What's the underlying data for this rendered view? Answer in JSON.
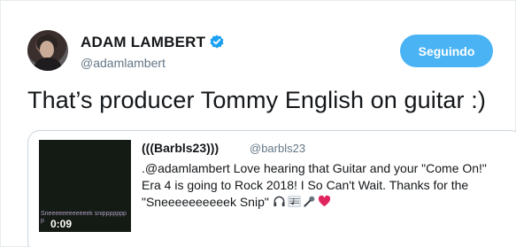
{
  "author": {
    "display_name": "ADAM LAMBERT",
    "handle": "@adamlambert",
    "verified": true,
    "avatar_icon": "user-avatar"
  },
  "follow_button": {
    "label": "Seguindo",
    "color": "#4ab3f4"
  },
  "tweet": {
    "text": "That’s producer Tommy English on guitar :)"
  },
  "quoted_tweet": {
    "display_name": "(((Barbls23)))",
    "handle": "@barbls23",
    "text": ".@adamlambert Love hearing that Guitar and your \"Come On!\" Era 4 is going to Rock 2018! I So Can't Wait. Thanks for the \"Sneeeeeeeeeek Snip\"",
    "emojis": [
      "headphones-icon",
      "musical-score-icon",
      "microphone-icon",
      "heart-icon"
    ],
    "media": {
      "duration": "0:09",
      "overlay_text": "Sneeeeeeeeeeeek snipppppppp"
    }
  },
  "colors": {
    "text_primary": "#14171a",
    "text_secondary": "#657786",
    "verified_blue": "#1da1f2",
    "heart_red": "#e0245e"
  }
}
